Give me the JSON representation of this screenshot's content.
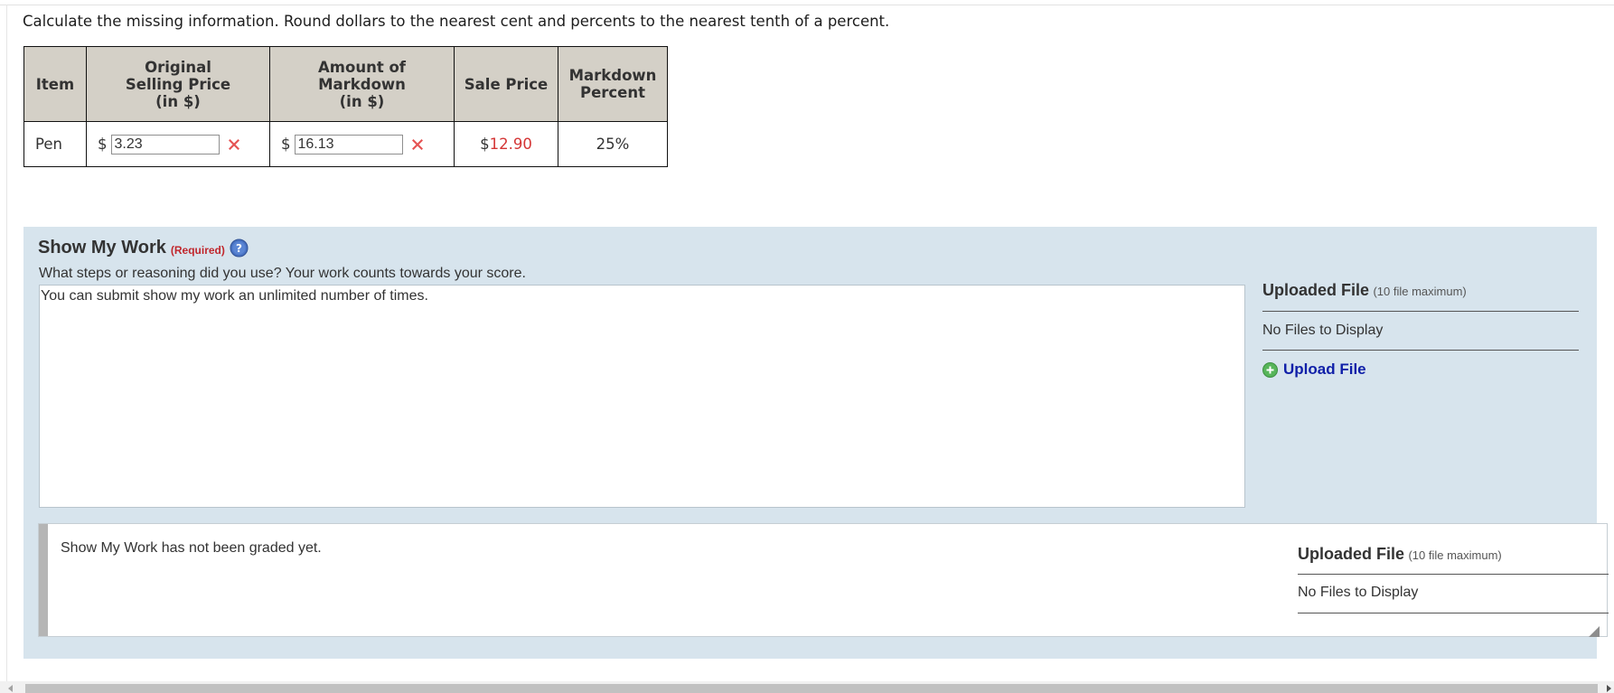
{
  "instructions": "Calculate the missing information. Round dollars to the nearest cent and percents to the nearest tenth of a percent.",
  "table": {
    "headers": {
      "item": "Item",
      "original_line1": "Original",
      "original_line2": "Selling Price",
      "original_line3": "(in $)",
      "amount_line1": "Amount of",
      "amount_line2": "Markdown",
      "amount_line3": "(in $)",
      "sale_price": "Sale Price",
      "markdown_line1": "Markdown",
      "markdown_line2": "Percent"
    },
    "row": {
      "item": "Pen",
      "currency_symbol": "$",
      "original_value": "3.23",
      "original_status": "incorrect",
      "amount_value": "16.13",
      "amount_status": "incorrect",
      "sale_dollar": "$",
      "sale_amount": "12.90",
      "markdown_percent": "25%"
    },
    "status_icon": "x-mark-icon",
    "colors": {
      "header_bg": "#d4d0c7",
      "incorrect": "#e55353",
      "highlight_red": "#d43535"
    }
  },
  "show_my_work": {
    "title": "Show My Work",
    "required_label": "(Required)",
    "help_icon": "question-mark-icon",
    "subtitle": "What steps or reasoning did you use? Your work counts towards your score.",
    "textarea_value": "You can submit show my work an unlimited number of times.",
    "background_color": "#d7e4ed",
    "uploaded": {
      "title": "Uploaded File",
      "max_note": "(10 file maximum)",
      "empty_text": "No Files to Display",
      "upload_link": "Upload File",
      "upload_icon": "plus-circle-icon"
    }
  },
  "graded_panel": {
    "message": "Show My Work has not been graded yet.",
    "uploaded": {
      "title": "Uploaded File",
      "max_note": "(10 file maximum)",
      "empty_text": "No Files to Display"
    }
  }
}
